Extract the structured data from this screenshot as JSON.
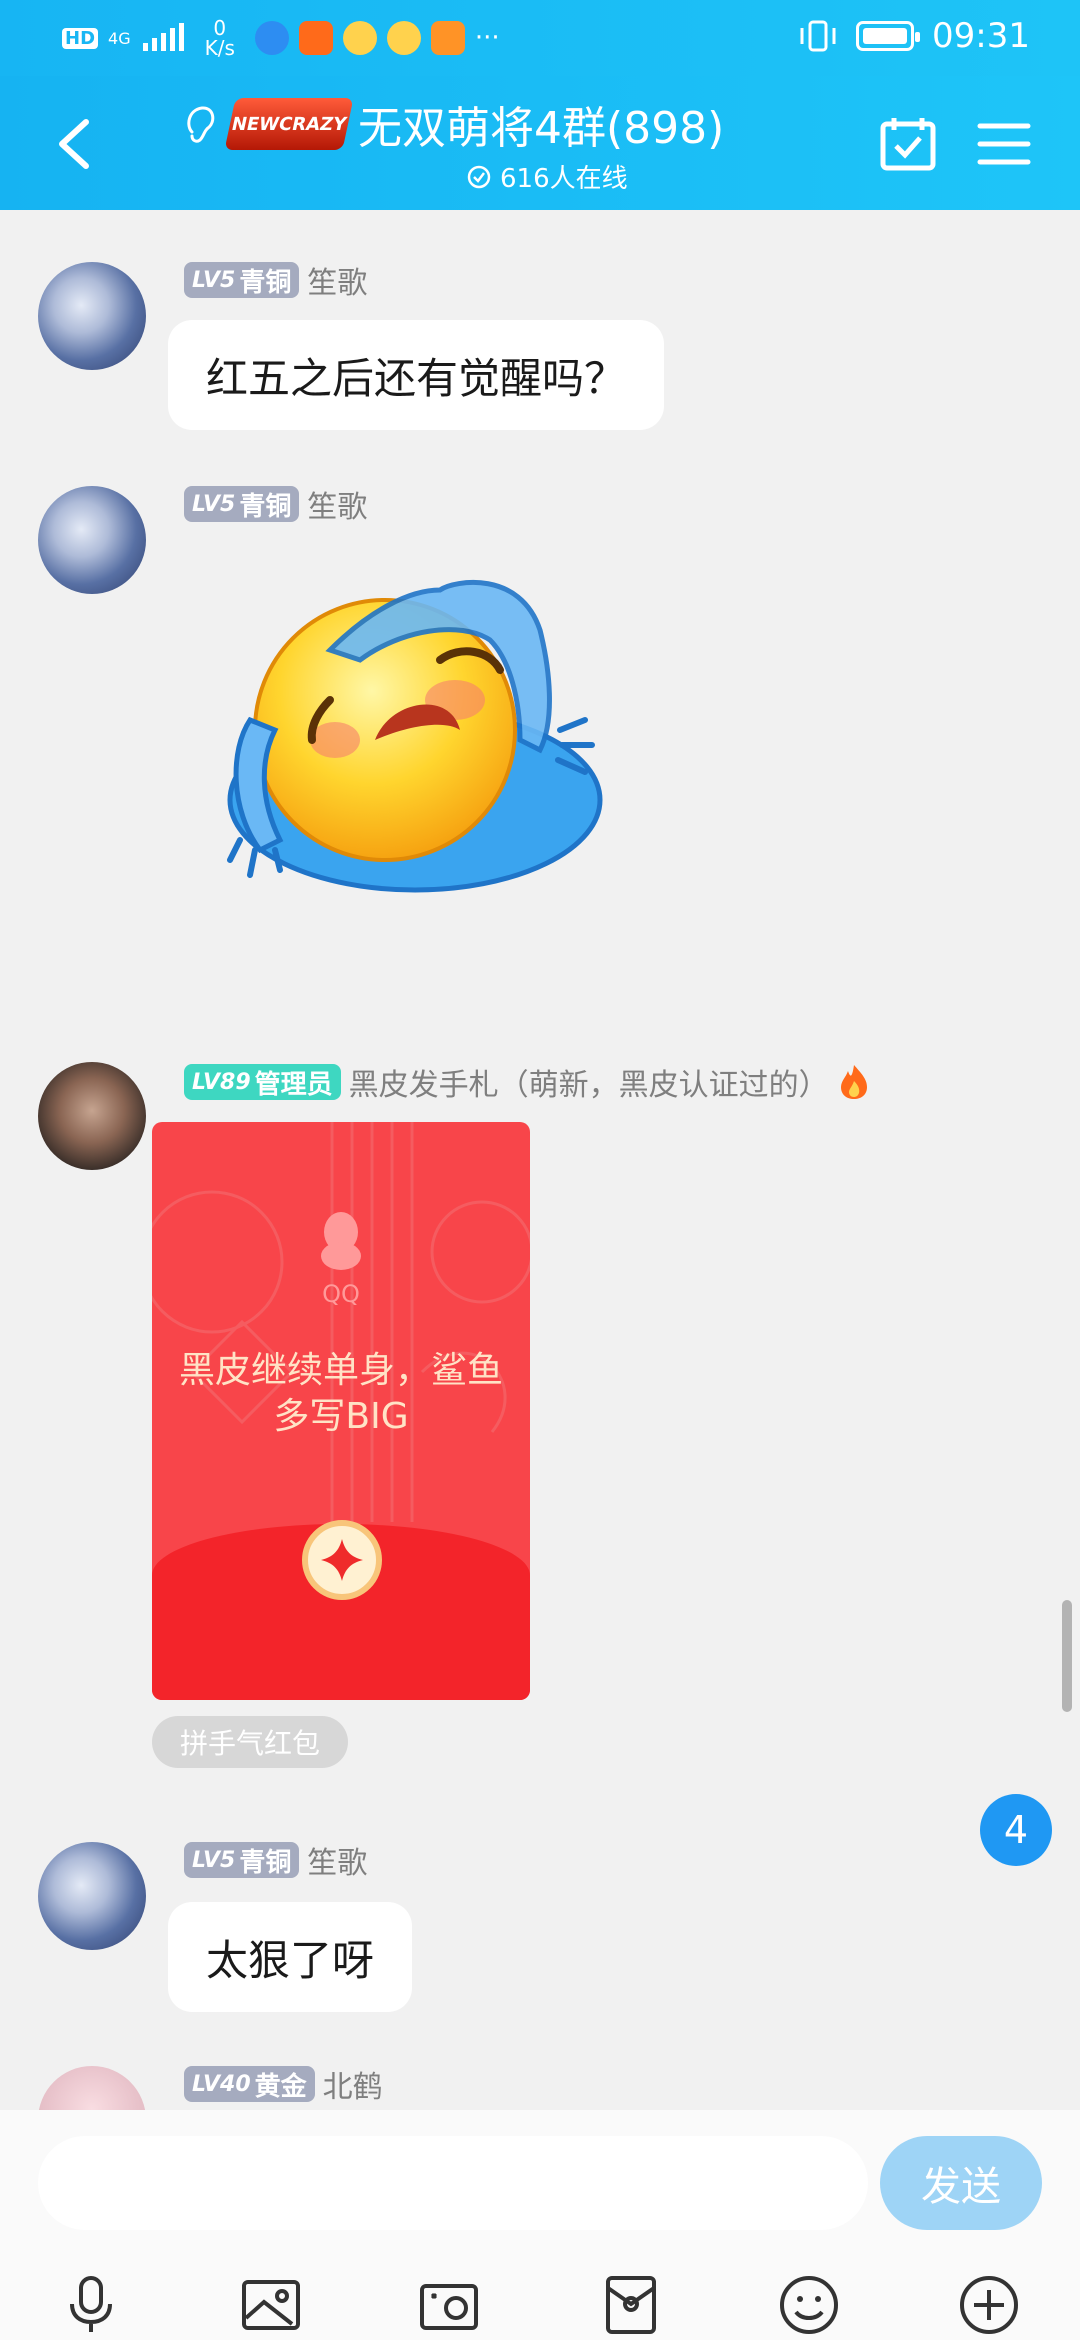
{
  "status_bar": {
    "network": "HD",
    "signal_tech": "4G",
    "speed_value": "0",
    "speed_unit": "K/s",
    "more": "···",
    "time": "09:31"
  },
  "header": {
    "title": "无双萌将4群(898)",
    "online": "616人在线",
    "logo_text": "NEWCRAZY"
  },
  "messages": [
    {
      "badge_lv": "LV5",
      "badge_title": "青铜",
      "nickname": "笙歌",
      "text": "红五之后还有觉醒吗？"
    },
    {
      "badge_lv": "LV5",
      "badge_title": "青铜",
      "nickname": "笙歌",
      "sticker": "crying-emoji-sticker"
    },
    {
      "badge_lv": "LV89",
      "badge_title": "管理员",
      "nickname": "黑皮发手札（萌新，黑皮认证过的）",
      "redpacket": {
        "brand": "QQ",
        "wish": "黑皮继续单身，鲨鱼多写BIG",
        "type_label": "拼手气红包"
      }
    },
    {
      "badge_lv": "LV5",
      "badge_title": "青铜",
      "nickname": "笙歌",
      "text": "太狠了呀"
    },
    {
      "badge_lv": "LV40",
      "badge_title": "黄金",
      "nickname": "北鹤"
    }
  ],
  "unread_count": "4",
  "input": {
    "placeholder": "",
    "send_label": "发送"
  },
  "toolbar": [
    "mic-icon",
    "image-icon",
    "camera-icon",
    "red-packet-icon",
    "emoji-icon",
    "plus-icon"
  ],
  "colors": {
    "header": "#1ab9f5",
    "admin_badge": "#3ed7c1",
    "level_badge": "#a5abbf",
    "red_packet": "#f8454a",
    "send_button": "#9ed4f6"
  }
}
